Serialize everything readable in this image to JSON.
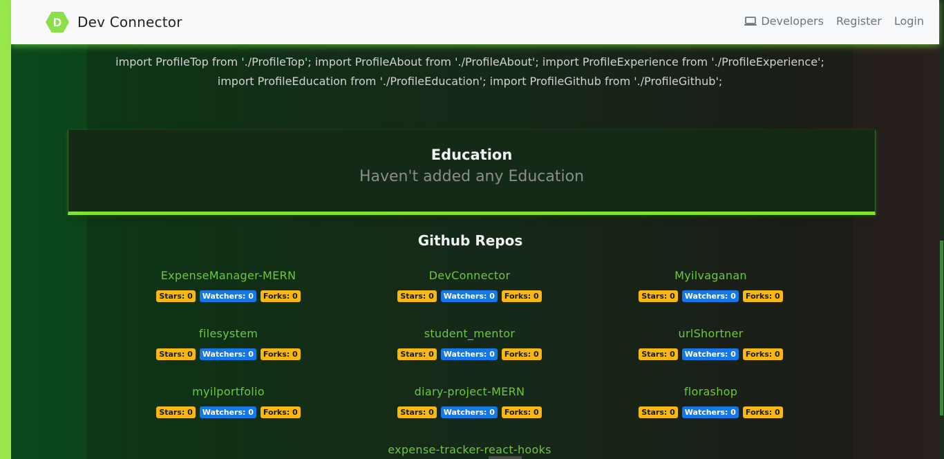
{
  "navbar": {
    "brand": "Dev Connector",
    "logo_letter": "D",
    "links": [
      {
        "label": "Developers",
        "icon": "laptop-icon"
      },
      {
        "label": "Register"
      },
      {
        "label": "Login"
      }
    ]
  },
  "about": {
    "text": "import ProfileTop from './ProfileTop'; import ProfileAbout from './ProfileAbout'; import ProfileExperience from './ProfileExperience'; import ProfileEducation from './ProfileEducation'; import ProfileGithub from './ProfileGithub';"
  },
  "education": {
    "title": "Education",
    "empty_text": "Haven't added any Education"
  },
  "github": {
    "title": "Github Repos",
    "repos": [
      {
        "name": "ExpenseManager-MERN",
        "stars": "Stars: 0",
        "watchers": "Watchers: 0",
        "forks": "Forks: 0"
      },
      {
        "name": "DevConnector",
        "stars": "Stars: 0",
        "watchers": "Watchers: 0",
        "forks": "Forks: 0"
      },
      {
        "name": "Myilvaganan",
        "stars": "Stars: 0",
        "watchers": "Watchers: 0",
        "forks": "Forks: 0"
      },
      {
        "name": "filesystem",
        "stars": "Stars: 0",
        "watchers": "Watchers: 0",
        "forks": "Forks: 0"
      },
      {
        "name": "student_mentor",
        "stars": "Stars: 0",
        "watchers": "Watchers: 0",
        "forks": "Forks: 0"
      },
      {
        "name": "urlShortner",
        "stars": "Stars: 0",
        "watchers": "Watchers: 0",
        "forks": "Forks: 0"
      },
      {
        "name": "myilportfolio",
        "stars": "Stars: 0",
        "watchers": "Watchers: 0",
        "forks": "Forks: 0"
      },
      {
        "name": "diary-project-MERN",
        "stars": "Stars: 0",
        "watchers": "Watchers: 0",
        "forks": "Forks: 0"
      },
      {
        "name": "florashop",
        "stars": "Stars: 0",
        "watchers": "Watchers: 0",
        "forks": "Forks: 0"
      },
      {
        "name": "expense-tracker-react-hooks"
      }
    ]
  },
  "colors": {
    "accent_green": "#7fe234",
    "repo_name_green": "#6dc83d",
    "badge_yellow": "#f7b812",
    "badge_blue": "#1677e6"
  }
}
